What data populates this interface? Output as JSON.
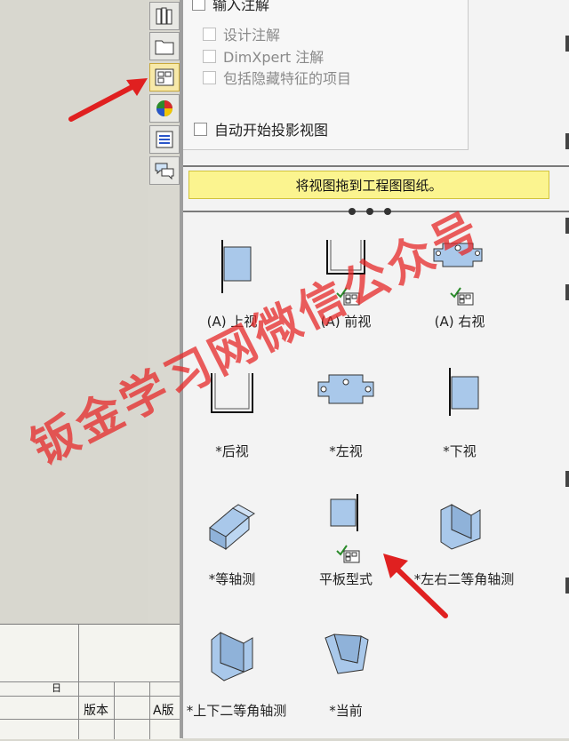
{
  "options": {
    "import_annotations": "输入注解",
    "design_annotations": "设计注解",
    "dimxpert_annotations": "DimXpert 注解",
    "include_hidden": "包括隐藏特征的项目",
    "auto_projection": "自动开始投影视图"
  },
  "hint": "将视图拖到工程图图纸。",
  "views": [
    {
      "label": "(A) 上视"
    },
    {
      "label": "(A) 前视"
    },
    {
      "label": "(A) 右视"
    },
    {
      "label": "*后视"
    },
    {
      "label": "*左视"
    },
    {
      "label": "*下视"
    },
    {
      "label": "*等轴测"
    },
    {
      "label": "平板型式"
    },
    {
      "label": "*左右二等角轴测"
    },
    {
      "label": "*上下二等角轴测"
    },
    {
      "label": "*当前"
    }
  ],
  "title_block": {
    "version": "版本",
    "a_version": "A版",
    "day": "日"
  },
  "watermark": "钣金学习网微信公众号",
  "colors": {
    "accent": "#fbf48f",
    "arrow": "#e02020",
    "part_fill": "#a9c8ea"
  }
}
